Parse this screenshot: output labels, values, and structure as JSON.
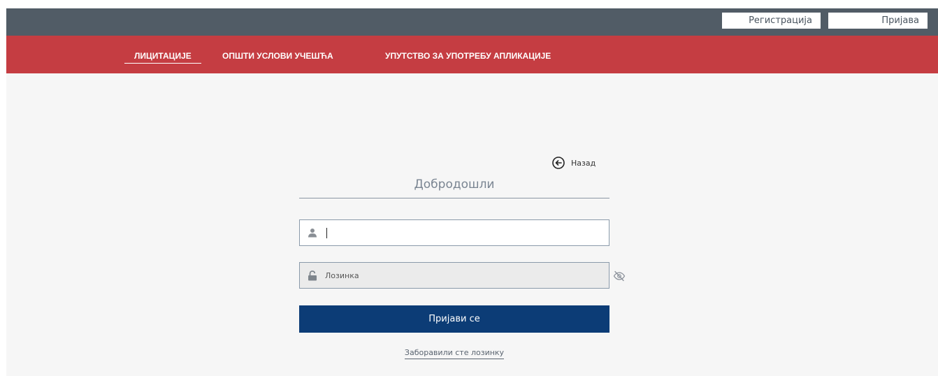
{
  "header": {
    "register_label": "Регистрација",
    "login_label": "Пријава"
  },
  "nav": {
    "items": [
      {
        "label": "ЛИЦИТАЦИЈЕ",
        "active": true
      },
      {
        "label": "ОПШТИ УСЛОВИ УЧЕШЋА",
        "active": false
      },
      {
        "label": "УПУТСТВО ЗА УПОТРЕБУ АПЛИКАЦИЈЕ",
        "active": false
      }
    ]
  },
  "login_form": {
    "back_label": "Назад",
    "welcome": "Добродошли",
    "username": {
      "value": "",
      "placeholder": ""
    },
    "password": {
      "value": "",
      "placeholder": "Лозинка"
    },
    "submit_label": "Пријави се",
    "forgot_label": "Заборавили сте лозинку"
  },
  "colors": {
    "topbar": "#515c66",
    "navbar": "#c53d42",
    "primary_button": "#0c3c76",
    "page_background": "#f6f6f6"
  },
  "icons": {
    "back": "arrow-left-circle-icon",
    "username": "user-icon",
    "password": "unlock-icon",
    "visibility": "eye-slash-icon"
  }
}
